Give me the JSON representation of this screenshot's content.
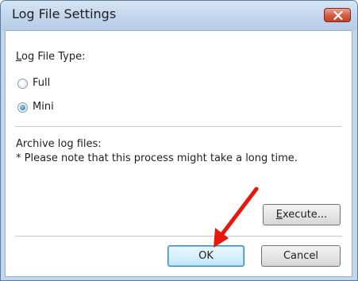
{
  "window": {
    "title": "Log File Settings"
  },
  "log_type": {
    "label": "Log File Type:",
    "options": [
      {
        "label": "Full",
        "selected": false
      },
      {
        "label": "Mini",
        "selected": true
      }
    ]
  },
  "archive": {
    "label": "Archive log files:",
    "note": "* Please note that this process might take a long time."
  },
  "buttons": {
    "execute": "Execute...",
    "ok": "OK",
    "cancel": "Cancel"
  },
  "annotation": {
    "arrow_color": "#e8170d"
  },
  "colors": {
    "title_bar": "#c3d6ec",
    "close_button": "#d35a42",
    "default_button_border": "#3c7fb1"
  }
}
